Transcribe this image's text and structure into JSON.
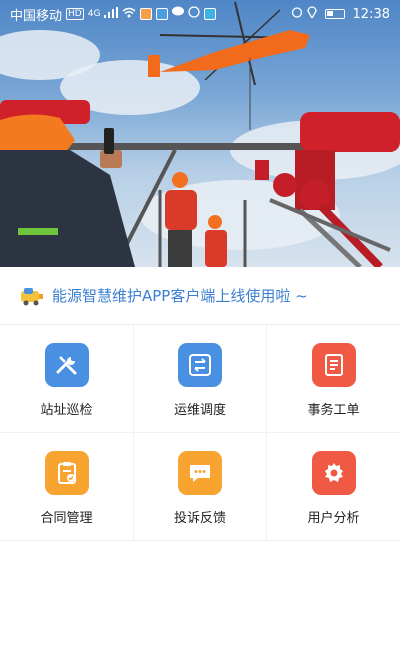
{
  "status_bar": {
    "carrier": "中国移动",
    "network_badge": "HD",
    "signal_text": "4G",
    "time": "12:38"
  },
  "hero": {
    "description_icon": "helicopter-lifting-equipment"
  },
  "notice": {
    "text": "能源智慧维护APP客户端上线使用啦 ~",
    "icon": "megaphone-truck-icon"
  },
  "menu": [
    {
      "label": "站址巡检",
      "icon": "tools-icon",
      "color": "#4a90e2"
    },
    {
      "label": "运维调度",
      "icon": "swap-icon",
      "color": "#4a90e2"
    },
    {
      "label": "事务工单",
      "icon": "document-icon",
      "color": "#f05a45"
    },
    {
      "label": "合同管理",
      "icon": "clipboard-check-icon",
      "color": "#f7a530"
    },
    {
      "label": "投诉反馈",
      "icon": "chat-bubble-icon",
      "color": "#f7a530"
    },
    {
      "label": "用户分析",
      "icon": "gear-icon",
      "color": "#f05a45"
    }
  ],
  "colors": {
    "blue": "#4a90e2",
    "red": "#f05a45",
    "orange": "#f7a530",
    "notice_text": "#3a7fd0"
  }
}
